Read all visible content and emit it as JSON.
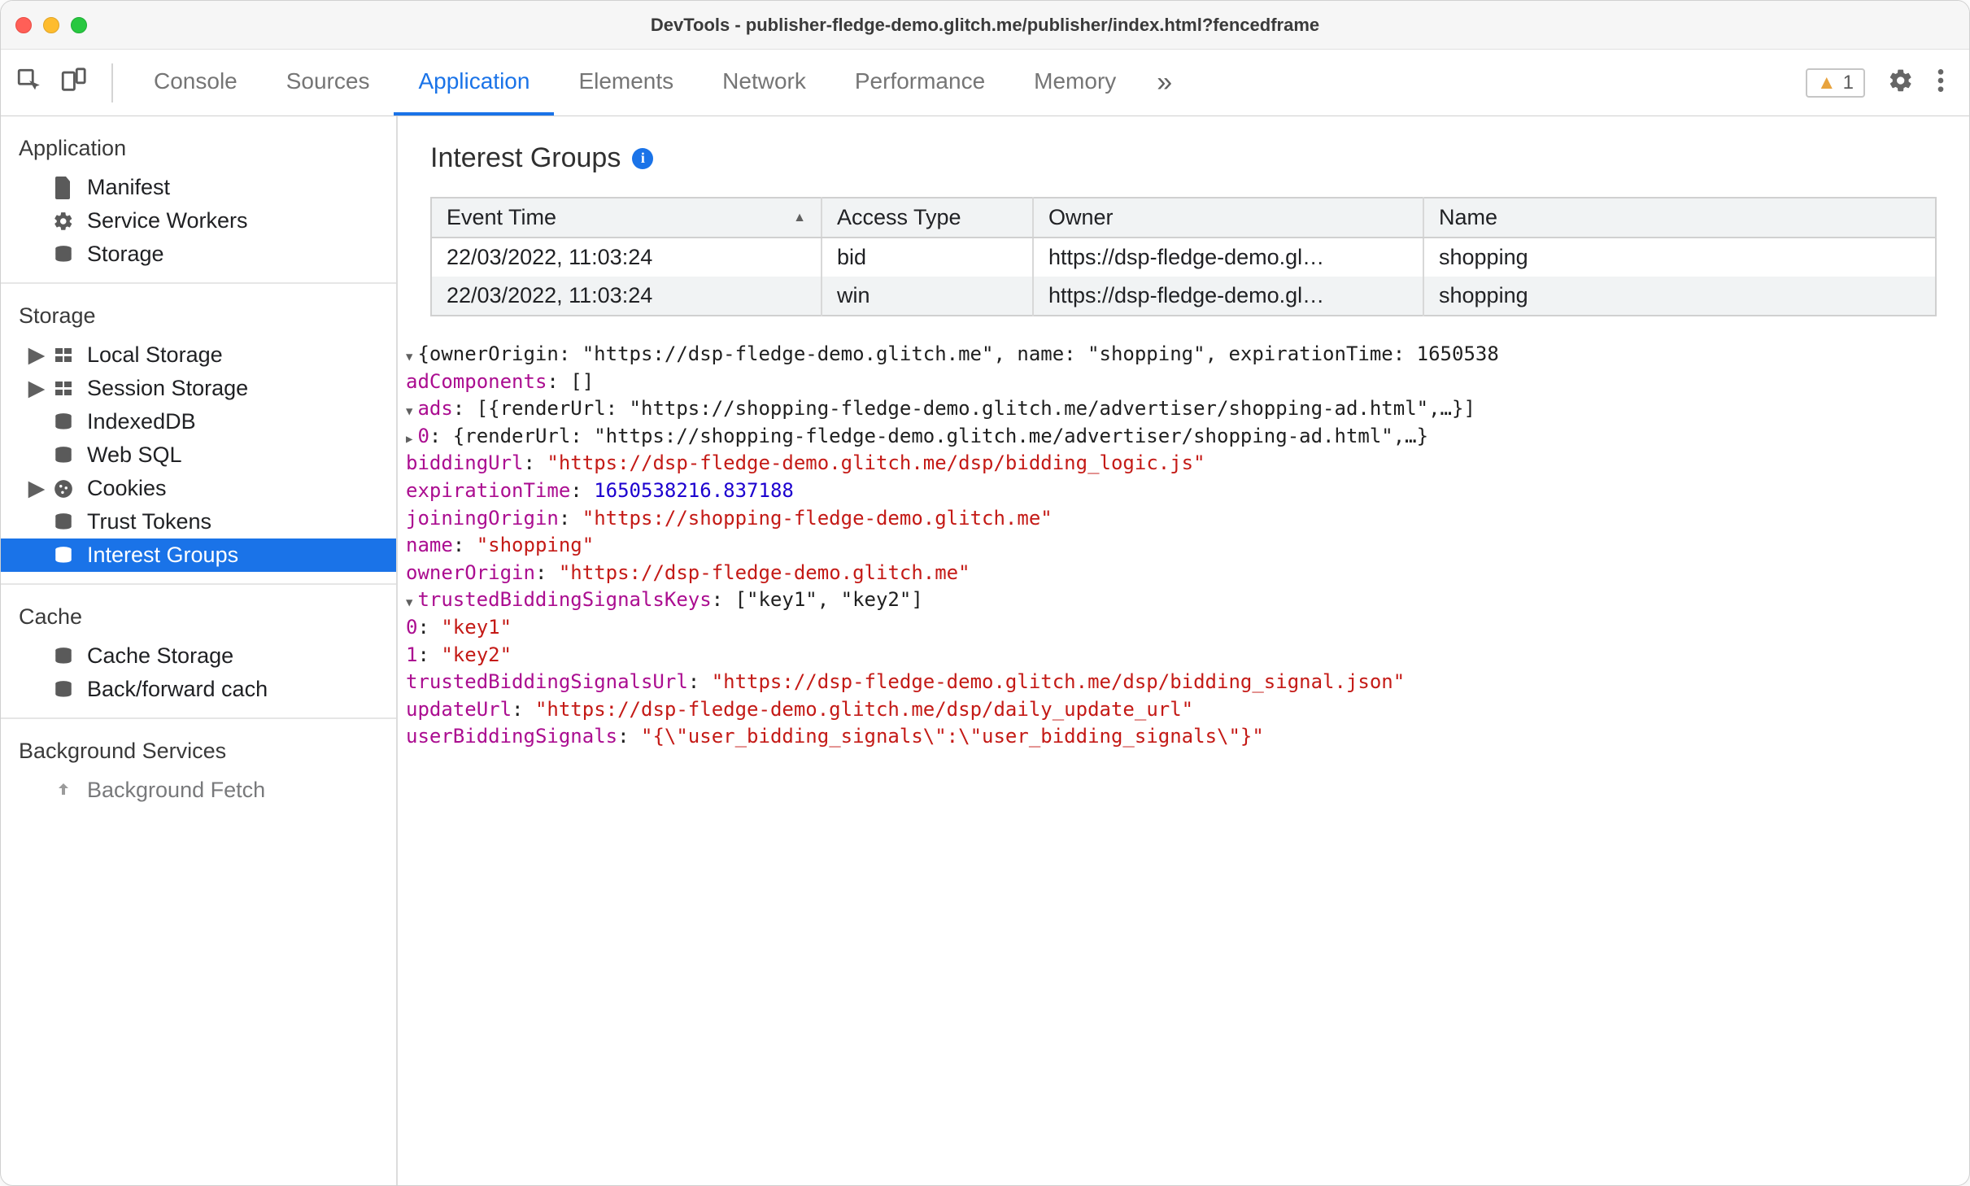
{
  "title": "DevTools - publisher-fledge-demo.glitch.me/publisher/index.html?fencedframe",
  "warnCount": "1",
  "tabs": [
    "Console",
    "Sources",
    "Application",
    "Elements",
    "Network",
    "Performance",
    "Memory"
  ],
  "activeTab": "Application",
  "sidebar": {
    "sections": [
      {
        "title": "Application",
        "items": [
          "Manifest",
          "Service Workers",
          "Storage"
        ]
      },
      {
        "title": "Storage",
        "items": [
          "Local Storage",
          "Session Storage",
          "IndexedDB",
          "Web SQL",
          "Cookies",
          "Trust Tokens",
          "Interest Groups"
        ]
      },
      {
        "title": "Cache",
        "items": [
          "Cache Storage",
          "Back/forward cach"
        ]
      },
      {
        "title": "Background Services",
        "items": [
          "Background Fetch"
        ]
      }
    ],
    "selected": "Interest Groups"
  },
  "paneTitle": "Interest Groups",
  "table": {
    "headers": [
      "Event Time",
      "Access Type",
      "Owner",
      "Name"
    ],
    "sortCol": 0,
    "rows": [
      [
        "22/03/2022, 11:03:24",
        "bid",
        "https://dsp-fledge-demo.gl…",
        "shopping"
      ],
      [
        "22/03/2022, 11:03:24",
        "win",
        "https://dsp-fledge-demo.gl…",
        "shopping"
      ]
    ]
  },
  "obj": {
    "topLinePrefix": "{ownerOrigin: ",
    "topOwnerOrigin": "\"https://dsp-fledge-demo.glitch.me\"",
    "topMid": ", name: ",
    "topName": "\"shopping\"",
    "topMid2": ", expirationTime: ",
    "topExp": "1650538",
    "adComponentsKey": "adComponents",
    "adComponentsVal": "[]",
    "adsKey": "ads",
    "adsSummary": "[{renderUrl: \"https://shopping-fledge-demo.glitch.me/advertiser/shopping-ad.html\",…}]",
    "ads0Key": "0",
    "ads0Summary": "{renderUrl: \"https://shopping-fledge-demo.glitch.me/advertiser/shopping-ad.html\",…}",
    "biddingUrlKey": "biddingUrl",
    "biddingUrlVal": "\"https://dsp-fledge-demo.glitch.me/dsp/bidding_logic.js\"",
    "expirationTimeKey": "expirationTime",
    "expirationTimeVal": "1650538216.837188",
    "joiningOriginKey": "joiningOrigin",
    "joiningOriginVal": "\"https://shopping-fledge-demo.glitch.me\"",
    "nameKey": "name",
    "nameVal": "\"shopping\"",
    "ownerOriginKey": "ownerOrigin",
    "ownerOriginVal": "\"https://dsp-fledge-demo.glitch.me\"",
    "tbskKey": "trustedBiddingSignalsKeys",
    "tbskVal": "[\"key1\", \"key2\"]",
    "tbsk0Key": "0",
    "tbsk0Val": "\"key1\"",
    "tbsk1Key": "1",
    "tbsk1Val": "\"key2\"",
    "tbsuKey": "trustedBiddingSignalsUrl",
    "tbsuVal": "\"https://dsp-fledge-demo.glitch.me/dsp/bidding_signal.json\"",
    "updateUrlKey": "updateUrl",
    "updateUrlVal": "\"https://dsp-fledge-demo.glitch.me/dsp/daily_update_url\"",
    "ubsKey": "userBiddingSignals",
    "ubsVal": "\"{\\\"user_bidding_signals\\\":\\\"user_bidding_signals\\\"}\""
  }
}
